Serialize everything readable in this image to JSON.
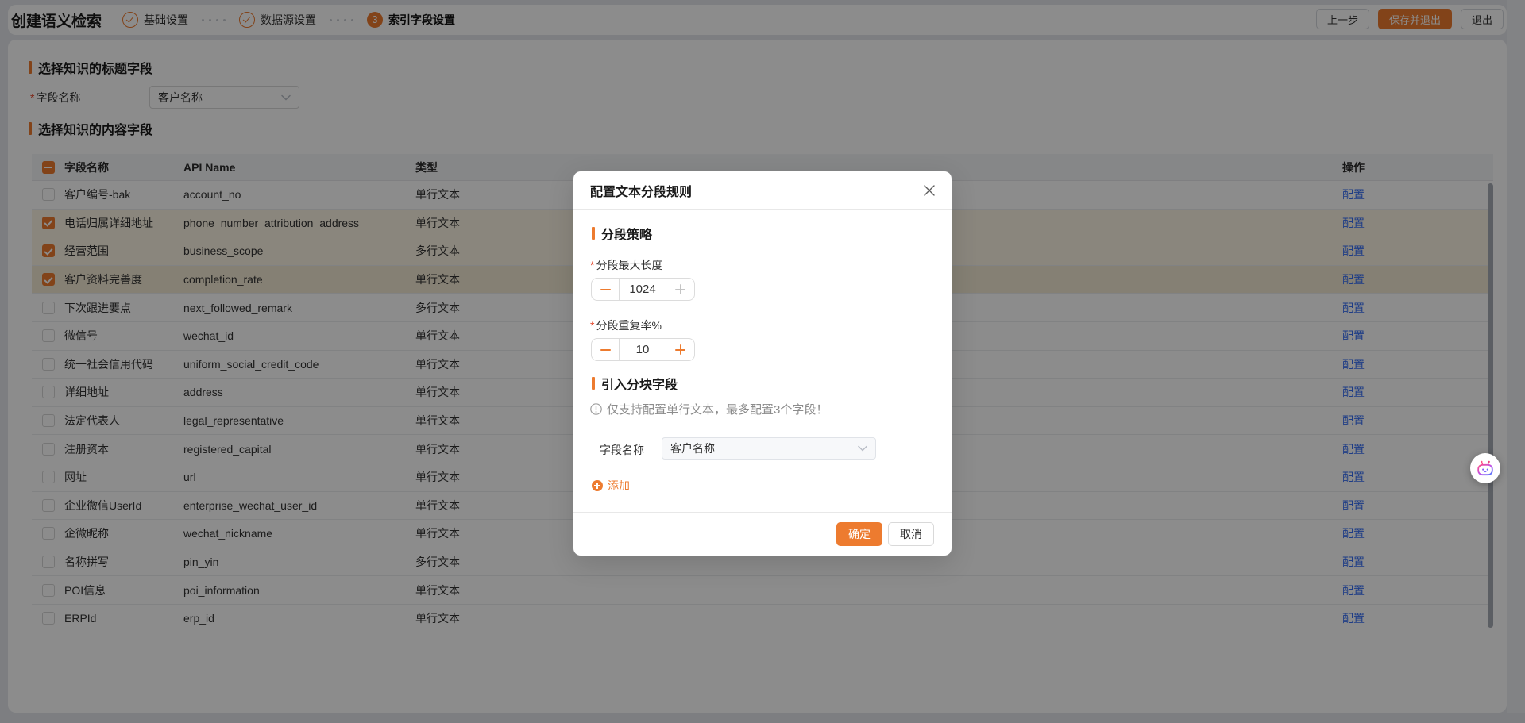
{
  "page_title": "创建语义检索",
  "required_mark": "*",
  "steps": [
    {
      "label": "基础设置",
      "status": "done"
    },
    {
      "label": "数据源设置",
      "status": "done"
    },
    {
      "label": "索引字段设置",
      "status": "active",
      "number": "3"
    }
  ],
  "header_actions": {
    "prev": "上一步",
    "save_exit": "保存并退出",
    "exit": "退出"
  },
  "sections": {
    "title": {
      "heading": "选择知识的标题字段",
      "field_label": "字段名称",
      "field_value": "客户名称"
    },
    "content": {
      "heading": "选择知识的内容字段"
    }
  },
  "table": {
    "columns": {
      "name": "字段名称",
      "api": "API Name",
      "type": "类型",
      "action": "操作"
    },
    "action_label": "配置",
    "select_all_state": "indeterminate",
    "rows": [
      {
        "name": "客户编号-bak",
        "api": "account_no",
        "type": "单行文本",
        "checked": false
      },
      {
        "name": "电话归属详细地址",
        "api": "phone_number_attribution_address",
        "type": "单行文本",
        "checked": true
      },
      {
        "name": "经营范围",
        "api": "business_scope",
        "type": "多行文本",
        "checked": true
      },
      {
        "name": "客户资料完善度",
        "api": "completion_rate",
        "type": "单行文本",
        "checked": true,
        "hovered": true
      },
      {
        "name": "下次跟进要点",
        "api": "next_followed_remark",
        "type": "多行文本",
        "checked": false
      },
      {
        "name": "微信号",
        "api": "wechat_id",
        "type": "单行文本",
        "checked": false
      },
      {
        "name": "统一社会信用代码",
        "api": "uniform_social_credit_code",
        "type": "单行文本",
        "checked": false
      },
      {
        "name": "详细地址",
        "api": "address",
        "type": "单行文本",
        "checked": false
      },
      {
        "name": "法定代表人",
        "api": "legal_representative",
        "type": "单行文本",
        "checked": false
      },
      {
        "name": "注册资本",
        "api": "registered_capital",
        "type": "单行文本",
        "checked": false
      },
      {
        "name": "网址",
        "api": "url",
        "type": "单行文本",
        "checked": false
      },
      {
        "name": "企业微信UserId",
        "api": "enterprise_wechat_user_id",
        "type": "单行文本",
        "checked": false
      },
      {
        "name": "企微昵称",
        "api": "wechat_nickname",
        "type": "单行文本",
        "checked": false
      },
      {
        "name": "名称拼写",
        "api": "pin_yin",
        "type": "多行文本",
        "checked": false
      },
      {
        "name": "POI信息",
        "api": "poi_information",
        "type": "单行文本",
        "checked": false
      },
      {
        "name": "ERPId",
        "api": "erp_id",
        "type": "单行文本",
        "checked": false
      }
    ]
  },
  "modal": {
    "title": "配置文本分段规则",
    "strategy_section": "分段策略",
    "max_length_label": "分段最大长度",
    "max_length_value": "1024",
    "overlap_label": "分段重复率%",
    "overlap_value": "10",
    "chunk_section": "引入分块字段",
    "info_text": "仅支持配置单行文本，最多配置3个字段！",
    "field_label": "字段名称",
    "field_value": "客户名称",
    "add_label": "添加",
    "ok_label": "确定",
    "cancel_label": "取消"
  },
  "colors": {
    "primary": "#ED7B2F",
    "link": "#366EF4",
    "selected_row_bg": "#FCF4E3",
    "overlay": "rgba(0,0,0,0.45)"
  }
}
